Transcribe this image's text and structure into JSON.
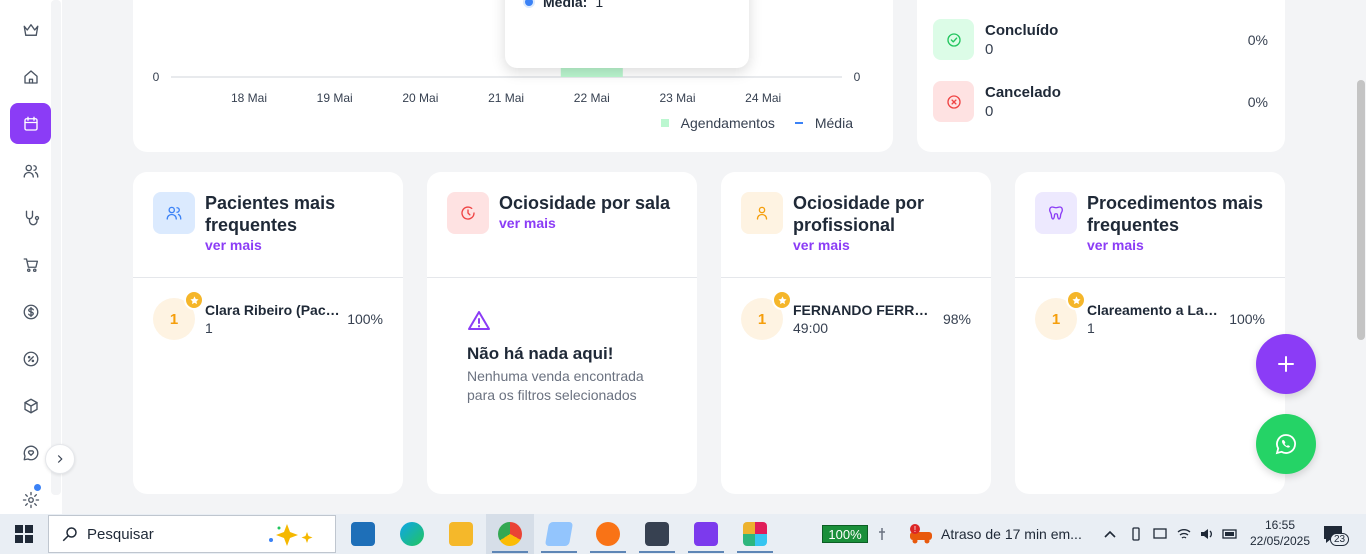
{
  "sidebar": {
    "items": [
      {
        "name": "crown-icon"
      },
      {
        "name": "home-icon"
      },
      {
        "name": "calendar-icon",
        "active": true
      },
      {
        "name": "users-icon"
      },
      {
        "name": "stethoscope-icon"
      },
      {
        "name": "cart-icon"
      },
      {
        "name": "dollar-icon"
      },
      {
        "name": "discount-icon"
      },
      {
        "name": "box-icon"
      },
      {
        "name": "heart-chat-icon"
      },
      {
        "name": "gear-icon"
      }
    ]
  },
  "chart_data": {
    "type": "bar",
    "categories": [
      "18 Mai",
      "19 Mai",
      "20 Mai",
      "21 Mai",
      "22 Mai",
      "23 Mai",
      "24 Mai"
    ],
    "series": [
      {
        "name": "Agendamentos",
        "values": [
          0,
          0,
          0,
          0,
          1,
          0,
          0
        ],
        "color": "#bbf7d0"
      },
      {
        "name": "Média",
        "values": [
          1,
          1,
          1,
          1,
          1,
          1,
          1
        ],
        "color": "#3b82f6"
      }
    ],
    "left_axis_visible_tick": "0",
    "right_axis_visible_tick": "0",
    "legend_position": "bottom-right",
    "tooltip": {
      "label": "Média:",
      "value": "1"
    }
  },
  "status": {
    "items": [
      {
        "title": "Concluído",
        "count": "0",
        "pct": "0%",
        "color": "#22c55e"
      },
      {
        "title": "Cancelado",
        "count": "0",
        "pct": "0%",
        "color": "#ef4444"
      }
    ]
  },
  "cards": {
    "patients": {
      "title": "Pacientes mais frequentes",
      "link": "ver mais",
      "rank": "1",
      "name": "Clara Ribeiro (Pacie...",
      "sub": "1",
      "pct": "100%"
    },
    "rooms": {
      "title": "Ociosidade por sala",
      "link": "ver mais",
      "empty_title": "Não há nada aqui!",
      "empty_desc": "Nenhuma venda encontrada para os filtros selecionados"
    },
    "professional": {
      "title": "Ociosidade por profissional",
      "link": "ver mais",
      "rank": "1",
      "name": "FERNANDO FERREI...",
      "sub": "49:00",
      "pct": "98%"
    },
    "procedures": {
      "title": "Procedimentos mais frequentes",
      "link": "ver mais",
      "rank": "1",
      "name": "Clareamento a Laser",
      "sub": "1",
      "pct": "100%"
    }
  },
  "taskbar": {
    "search_placeholder": "Pesquisar",
    "battery": "100%",
    "weather": "Atraso de 17 min em...",
    "time": "16:55",
    "date": "22/05/2025",
    "notifications": "23",
    "apps": [
      "desktop-icon",
      "edge-icon",
      "explorer-icon",
      "chrome-icon",
      "notepad-icon",
      "app-icon",
      "calculator-icon",
      "visual-studio-icon",
      "slack-icon"
    ]
  },
  "colors": {
    "accent": "#8b3cf6",
    "whatsapp": "#25d366"
  }
}
